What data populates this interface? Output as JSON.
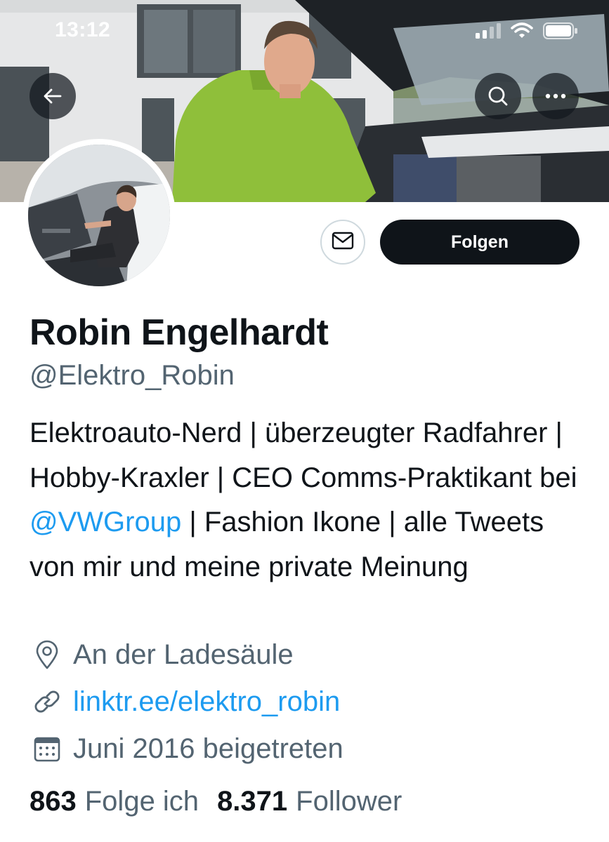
{
  "status_bar": {
    "time": "13:12"
  },
  "header": {
    "back_icon": "arrow-left-icon",
    "search_icon": "search-icon",
    "more_icon": "more-horizontal-icon"
  },
  "profile": {
    "display_name": "Robin Engelhardt",
    "handle": "@Elektro_Robin",
    "bio": {
      "part1": "Elektroauto-Nerd | überzeugter Radfahrer | Hobby-Kraxler | CEO Comms-Praktikant bei ",
      "mention": "@VWGroup",
      "part2": " | Fashion Ikone | alle Tweets von mir und meine private Meinung"
    },
    "location": "An der Ladesäule",
    "website": "linktr.ee/elektro_robin",
    "joined": "Juni 2016 beigetreten"
  },
  "actions": {
    "message_icon": "mail-icon",
    "follow_label": "Folgen"
  },
  "stats": {
    "following_count": "863",
    "following_label": "Folge ich",
    "followers_count": "8.371",
    "followers_label": "Follower"
  },
  "colors": {
    "accent": "#1d9bf0",
    "text_primary": "#0f1419",
    "text_secondary": "#536471",
    "button_dark": "#0f1419"
  }
}
